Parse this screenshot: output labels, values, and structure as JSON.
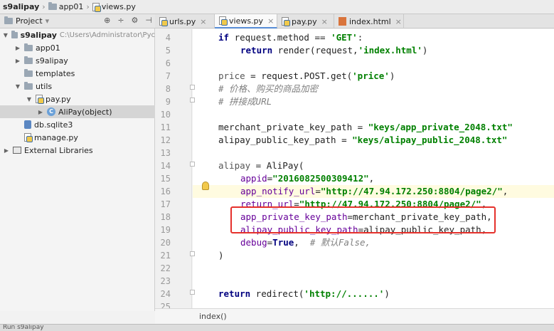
{
  "breadcrumb": [
    "s9alipay",
    "app01",
    "views.py"
  ],
  "project_panel": {
    "title": "Project",
    "tools": [
      "⊕",
      "÷",
      "⚙",
      "⊣"
    ]
  },
  "tree": [
    {
      "label": "s9alipay",
      "detail": "C:\\Users\\Administrator\\Pyc",
      "icon": "folder-icon",
      "arrow": "▼"
    },
    {
      "label": "app01",
      "icon": "folder-icon",
      "arrow": "▶"
    },
    {
      "label": "s9alipay",
      "icon": "folder-icon",
      "arrow": "▶"
    },
    {
      "label": "templates",
      "icon": "folder-icon",
      "arrow": ""
    },
    {
      "label": "utils",
      "icon": "folder-icon",
      "arrow": "▼"
    },
    {
      "label": "pay.py",
      "icon": "python-file-icon",
      "arrow": "▼"
    },
    {
      "label": "AliPay(object)",
      "icon": "class-icon",
      "arrow": "▶"
    },
    {
      "label": "db.sqlite3",
      "icon": "database-icon",
      "arrow": ""
    },
    {
      "label": "manage.py",
      "icon": "python-file-icon",
      "arrow": ""
    },
    {
      "label": "External Libraries",
      "icon": "library-icon",
      "arrow": "▶"
    }
  ],
  "tabs": [
    {
      "label": "urls.py",
      "active": false
    },
    {
      "label": "views.py",
      "active": true
    },
    {
      "label": "pay.py",
      "active": false
    },
    {
      "label": "index.html",
      "active": false
    }
  ],
  "line_numbers": [
    "4",
    "5",
    "6",
    "7",
    "8",
    "9",
    "10",
    "11",
    "12",
    "13",
    "14",
    "15",
    "16",
    "17",
    "18",
    "19",
    "20",
    "21",
    "22",
    "23",
    "24",
    "25"
  ],
  "code": {
    "l4_kw": "if",
    "l4_a": " request.method == ",
    "l4_str": "'GET'",
    "l4_b": ":",
    "l5_kw": "return",
    "l5_a": " render(request,",
    "l5_str": "'index.html'",
    "l5_b": ")",
    "l7_a": "price",
    "l7_b": " = request.POST.get(",
    "l7_str": "'price'",
    "l7_c": ")",
    "l8_cm": "# 价格、购买的商品加密",
    "l9_cm": "# 拼接成URL",
    "l11_a": "merchant_private_key_path = ",
    "l11_str": "\"keys/app_private_2048.txt\"",
    "l12_a": "alipay_public_key_path = ",
    "l12_str": "\"keys/alipay_public_2048.txt\"",
    "l14_a": "alipay",
    "l14_b": " = AliPay(",
    "l15_pm": "appid",
    "l15_a": "=",
    "l15_str": "\"2016082500309412\"",
    "l15_b": ",",
    "l16_pm": "app_notify_url",
    "l16_a": "=",
    "l16_str": "\"http://47.94.172.250:8804/page2/\"",
    "l16_b": ",",
    "l17_pm": "return_url",
    "l17_a": "=",
    "l17_str": "\"http://47.94.172.250:8804/page2/\"",
    "l17_b": ",",
    "l18_pm": "app_private_key_path",
    "l18_a": "=merchant_private_key_path,",
    "l19_pm": "alipay_public_key_path",
    "l19_a": "=alipay_public_key_path,",
    "l20_pm": "debug",
    "l20_a": "=",
    "l20_kw": "True",
    "l20_b": ",  ",
    "l20_cm": "# 默认False,",
    "l21_a": ")",
    "l24_kw": "return",
    "l24_a": " redirect(",
    "l24_str": "'http://......'",
    "l24_b": ")"
  },
  "bottom_crumb": "index()",
  "status": "Run  s9alipay",
  "colors": {
    "highlight_box": "#e5312c",
    "keyword": "#000080",
    "string": "#008000",
    "param": "#660099",
    "comment": "#808080"
  }
}
